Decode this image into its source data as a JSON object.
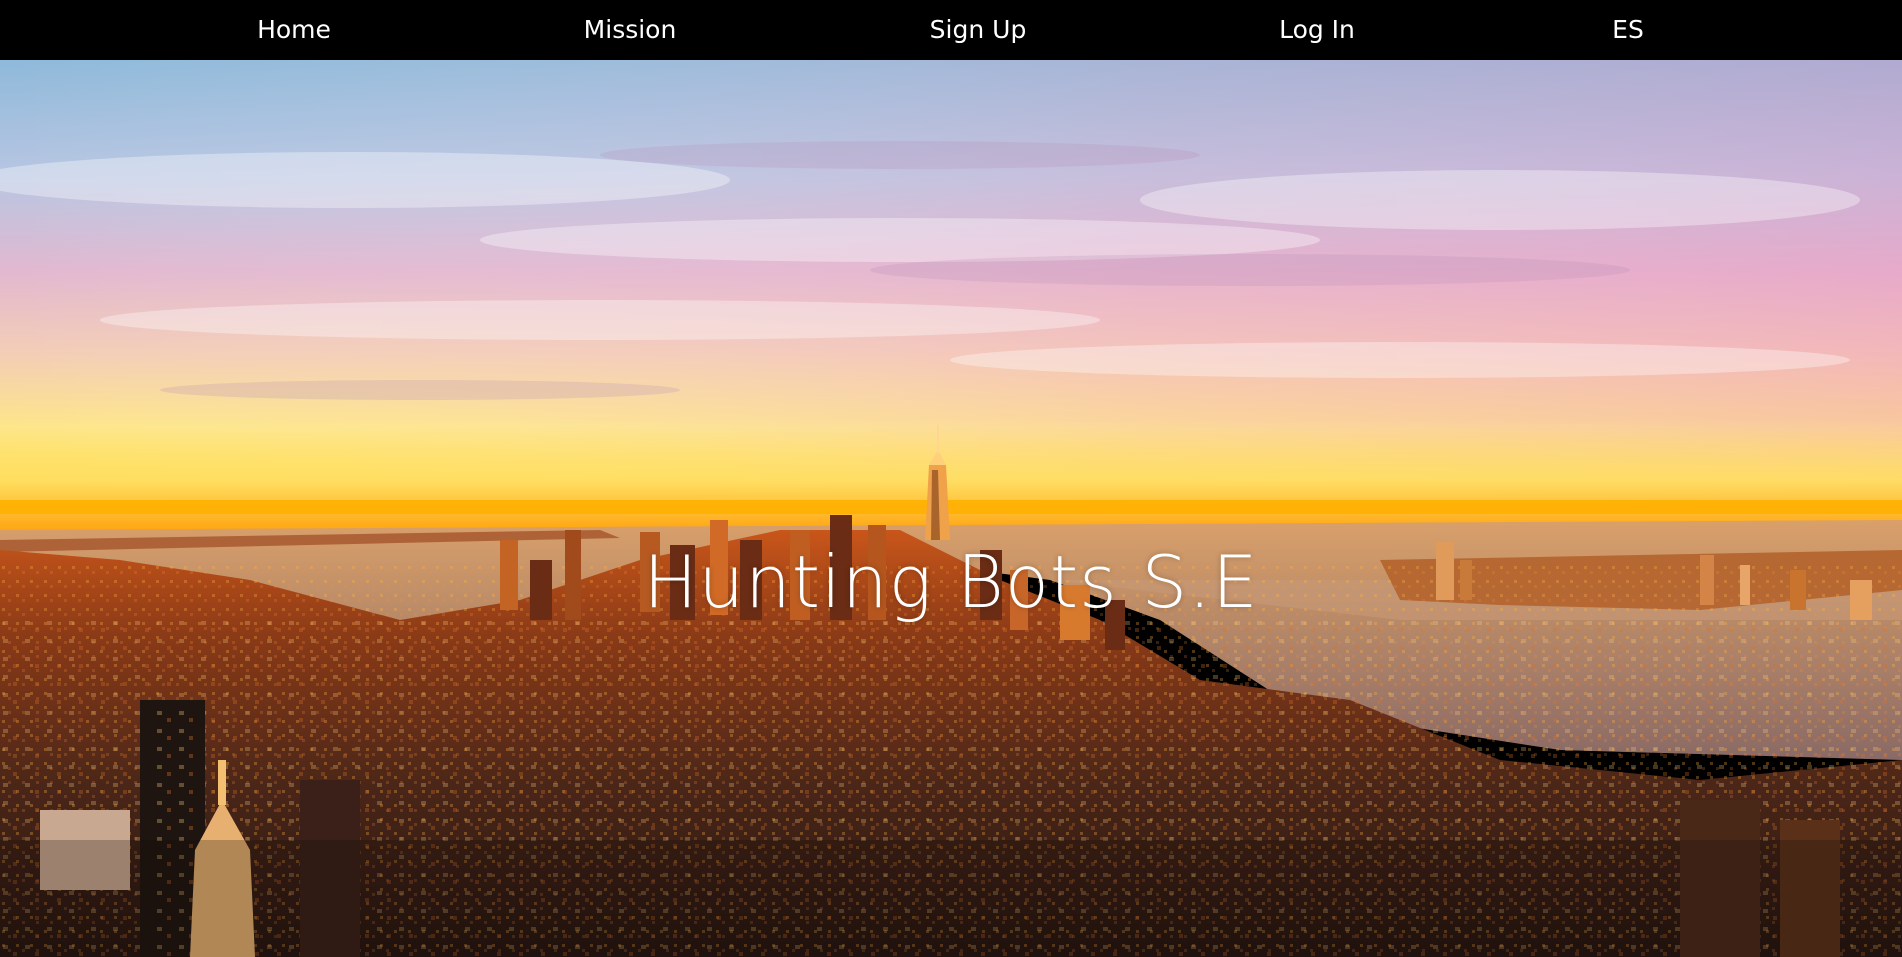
{
  "nav": {
    "items": [
      {
        "id": "home",
        "label": "Home"
      },
      {
        "id": "mission",
        "label": "Mission"
      },
      {
        "id": "signup",
        "label": "Sign Up"
      },
      {
        "id": "login",
        "label": "Log In"
      },
      {
        "id": "lang",
        "label": "ES"
      }
    ]
  },
  "hero": {
    "title": "Hunting Bots S.E",
    "background": "city-skyline-sunset-photo"
  },
  "colors": {
    "nav_bg": "#000000",
    "nav_text": "#ffffff",
    "title_text": "#ffffff",
    "sky_top": "#9fc3e0",
    "sky_mid": "#e9b6c6",
    "horizon": "#ffc21a",
    "water": "#b98a6a",
    "city_dark": "#3a2418"
  }
}
